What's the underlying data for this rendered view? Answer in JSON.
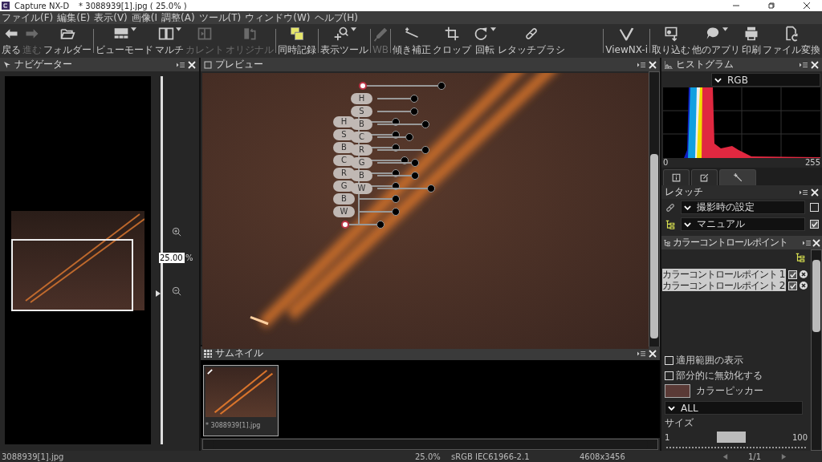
{
  "window": {
    "app": "Capture NX-D",
    "document": "* 3088939[1].jpg ( 25.0% )"
  },
  "menu": [
    "ファイル(F)",
    "編集(E)",
    "表示(V)",
    "画像(I",
    "調整(A)",
    "ツール(T)",
    "ウィンドウ(W)",
    "ヘルプ(H)"
  ],
  "toolbar": {
    "left": [
      [
        {
          "kind": "back",
          "label": "戻る",
          "disabled": false,
          "dropdown": false
        },
        {
          "kind": "forward",
          "label": "進む",
          "disabled": true,
          "dropdown": false
        },
        {
          "kind": "folder",
          "label": "フォルダー",
          "disabled": false,
          "dropdown": false
        }
      ],
      [
        {
          "kind": "viewmode",
          "label": "ビューモード",
          "disabled": false,
          "dropdown": true
        },
        {
          "kind": "multi",
          "label": "マルチ",
          "disabled": false,
          "dropdown": true
        },
        {
          "kind": "current",
          "label": "カレント",
          "disabled": true,
          "dropdown": false
        },
        {
          "kind": "original",
          "label": "オリジナル",
          "disabled": true,
          "dropdown": false
        }
      ],
      [
        {
          "kind": "sync",
          "label": "同時記録",
          "disabled": false,
          "dropdown": false
        }
      ],
      [
        {
          "kind": "zoomtool",
          "label": "表示ツール",
          "disabled": false,
          "dropdown": true
        }
      ],
      [
        {
          "kind": "wb",
          "label": "WB",
          "disabled": true,
          "dropdown": false
        }
      ],
      [
        {
          "kind": "straighten",
          "label": "傾き補正",
          "disabled": false,
          "dropdown": false
        },
        {
          "kind": "crop",
          "label": "クロップ",
          "disabled": false,
          "dropdown": false
        },
        {
          "kind": "rotate",
          "label": "回転",
          "disabled": false,
          "dropdown": true
        },
        {
          "kind": "brush",
          "label": "レタッチブラシ",
          "disabled": false,
          "dropdown": false
        }
      ]
    ],
    "right": [
      [
        {
          "kind": "viewnx",
          "label": "ViewNX-i",
          "disabled": false,
          "dropdown": false
        }
      ],
      [
        {
          "kind": "import",
          "label": "取り込む",
          "disabled": false,
          "dropdown": false
        },
        {
          "kind": "apps",
          "label": "他のアプリ",
          "disabled": false,
          "dropdown": true
        },
        {
          "kind": "print",
          "label": "印刷",
          "disabled": false,
          "dropdown": false
        },
        {
          "kind": "convert",
          "label": "ファイル変換",
          "disabled": false,
          "dropdown": false
        }
      ]
    ]
  },
  "navigator": {
    "title": "ナビゲーター",
    "zoom_value": "25.00",
    "zoom_unit": "%",
    "zoom_slider": {
      "level": 0.4
    }
  },
  "preview": {
    "title": "プレビュー",
    "control_points": [
      {
        "sliders": [
          {
            "label": "H"
          },
          {
            "label": "S"
          },
          {
            "label": "B"
          },
          {
            "label": "C"
          },
          {
            "label": "R"
          },
          {
            "label": "G"
          },
          {
            "label": "B"
          },
          {
            "label": "W"
          }
        ]
      },
      {
        "sliders": [
          {
            "label": "H"
          },
          {
            "label": "S"
          },
          {
            "label": "B"
          },
          {
            "label": "C"
          },
          {
            "label": "R"
          },
          {
            "label": "G"
          },
          {
            "label": "B"
          },
          {
            "label": "W"
          }
        ]
      }
    ]
  },
  "thumbnails": {
    "title": "サムネイル",
    "items": [
      {
        "caption": "* 3088939[1].jpg",
        "selected": true
      }
    ]
  },
  "histogram": {
    "title": "ヒストグラム",
    "channel": "RGB",
    "axis_min": "0",
    "axis_max": "255"
  },
  "tabs": [
    {
      "kind": "info",
      "selected": false
    },
    {
      "kind": "edit",
      "selected": false
    },
    {
      "kind": "retouch",
      "selected": true
    }
  ],
  "retouch": {
    "title": "レタッチ",
    "rows": [
      {
        "kind": "bandage",
        "value": "撮影時の設定",
        "checked": false
      },
      {
        "kind": "tree",
        "value": "マニュアル",
        "checked": true
      }
    ]
  },
  "color_control_points": {
    "title": "カラーコントロールポイント",
    "points": [
      {
        "name": "カラーコントロールポイント 1",
        "enabled": true
      },
      {
        "name": "カラーコントロールポイント 2",
        "enabled": true
      }
    ],
    "options": [
      {
        "label": "適用範囲の表示",
        "checked": false
      },
      {
        "label": "部分的に無効化する",
        "checked": false
      }
    ],
    "picker_label": "カラーピッカー",
    "channel": "ALL",
    "size_label": "サイズ",
    "size_min": "1",
    "size_max": "100",
    "size_slider": {
      "level": 0.5
    }
  },
  "status_bar": {
    "file": "3088939[1].jpg",
    "zoom": "25.0%",
    "profile": "sRGB IEC61966-2.1",
    "dimensions": "4608x3456",
    "page": "1/1"
  }
}
